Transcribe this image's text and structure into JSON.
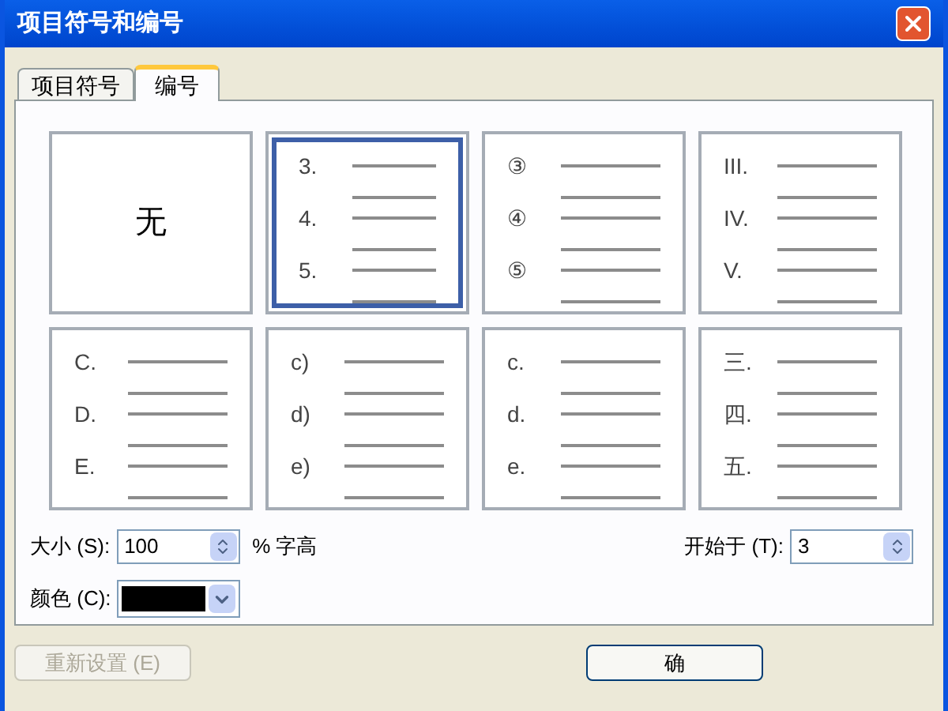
{
  "window": {
    "title": "项目符号和编号"
  },
  "tabs": [
    {
      "label": "项目符号",
      "selected": false
    },
    {
      "label": "编号",
      "selected": true
    }
  ],
  "styles": [
    {
      "kind": "none",
      "label": "无",
      "selected": false
    },
    {
      "kind": "list",
      "markers": [
        "3.",
        "4.",
        "5."
      ],
      "selected": true
    },
    {
      "kind": "list",
      "markers": [
        "③",
        "④",
        "⑤"
      ],
      "selected": false
    },
    {
      "kind": "list",
      "markers": [
        "III.",
        "IV.",
        "V."
      ],
      "selected": false
    },
    {
      "kind": "list",
      "markers": [
        "C.",
        "D.",
        "E."
      ],
      "selected": false
    },
    {
      "kind": "list",
      "markers": [
        "c)",
        "d)",
        "e)"
      ],
      "selected": false
    },
    {
      "kind": "list",
      "markers": [
        "c.",
        "d.",
        "e."
      ],
      "selected": false
    },
    {
      "kind": "list",
      "markers": [
        "三.",
        "四.",
        "五."
      ],
      "selected": false
    }
  ],
  "size": {
    "label": "大小 (S):",
    "value": "100",
    "unit": "% 字高"
  },
  "start": {
    "label": "开始于 (T):",
    "value": "3"
  },
  "color": {
    "label": "颜色 (C):",
    "color": "#000000"
  },
  "buttons": [
    {
      "label": "重新设置 (E)",
      "disabled": true
    },
    {
      "label": "确",
      "disabled": false
    }
  ]
}
